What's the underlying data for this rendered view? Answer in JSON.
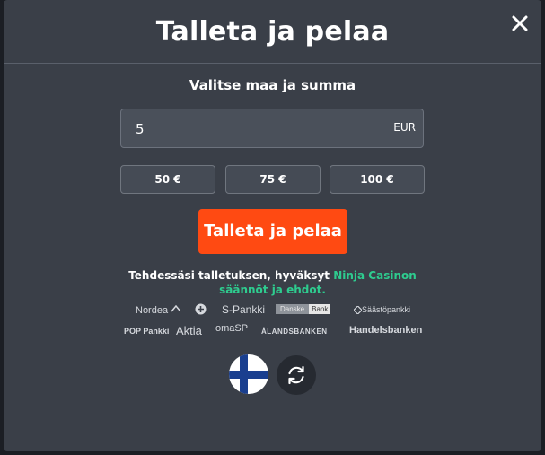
{
  "modal": {
    "title": "Talleta ja pelaa",
    "subtitle": "Valitse maa ja summa"
  },
  "amount": {
    "value": "5",
    "currency": "EUR"
  },
  "presets": [
    {
      "label": "50 €"
    },
    {
      "label": "75 €"
    },
    {
      "label": "100 €"
    }
  ],
  "cta": {
    "label": "Talleta ja pelaa"
  },
  "terms": {
    "text": "Tehdessäsi talletuksen, hyväksyt",
    "link_text": "Ninja Casinon säännöt ja ehdot."
  },
  "banks": [
    {
      "name": "Nordea"
    },
    {
      "name": "S-Pankki"
    },
    {
      "name": "Danske"
    },
    {
      "name": "Bank"
    },
    {
      "name": "Säästöpankki"
    },
    {
      "name": "POP Pankki"
    },
    {
      "name": "Aktia"
    },
    {
      "name": "omaSP"
    },
    {
      "name": "ÅLANDSBANKEN"
    },
    {
      "name": "Handelsbanken"
    }
  ],
  "country": {
    "flag_icon": "finland-flag-icon"
  },
  "colors": {
    "modal_bg": "#3a3f48",
    "cta": "#ff4a12",
    "link": "#2ecc8f"
  }
}
